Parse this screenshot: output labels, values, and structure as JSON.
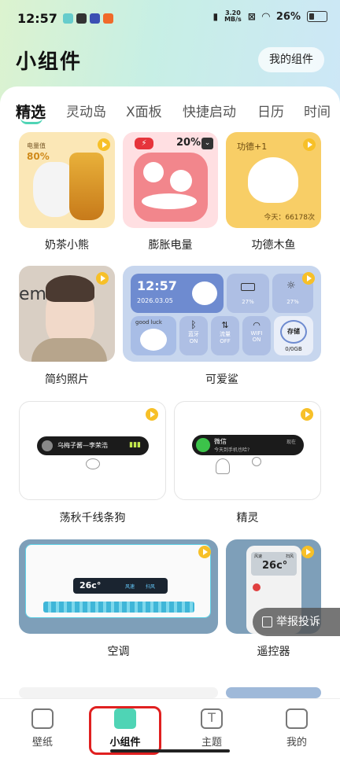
{
  "status_bar": {
    "time": "12:57",
    "speed_value": "3.20",
    "speed_unit": "MB/s",
    "battery": "26%"
  },
  "header": {
    "title": "小组件",
    "my_widgets_button": "我的组件"
  },
  "tabs": [
    "精选",
    "灵动岛",
    "X面板",
    "快捷启动",
    "日历",
    "时间"
  ],
  "widgets": {
    "milk_tea_bear": {
      "label": "奶茶小熊",
      "badge_title": "电量值",
      "badge_value": "80%"
    },
    "inflate_battery": {
      "label": "膨胀电量",
      "percent": "20%"
    },
    "merit_fish": {
      "label": "功德木鱼",
      "title": "功德+1",
      "today": "今天：66178次"
    },
    "simple_photo": {
      "label": "简约照片",
      "bg_text": "emb"
    },
    "cute_shark": {
      "label": "可爱鲨",
      "time": "12:57",
      "date": "2026.03.05",
      "tag": "good luck",
      "battery_a": "27%",
      "battery_b": "27%",
      "bluetooth": "蓝牙",
      "bluetooth_state": "ON",
      "data": "流量",
      "data_state": "OFF",
      "wifi": "WIFI",
      "wifi_state": "ON",
      "storage": "存储",
      "storage_value": "0/0GB"
    },
    "swing_dog": {
      "label": "荡秋千线条狗",
      "song": "乌梅子酱—李荣浩"
    },
    "spirit": {
      "label": "精灵",
      "title": "微信",
      "subtitle": "今天到手机也哈?",
      "time": "现在"
    },
    "air_conditioner": {
      "label": "空调",
      "temp": "26c°",
      "mode": "风速",
      "mode2": "扫风"
    },
    "remote": {
      "label": "遥控器",
      "temp": "26c°",
      "top_left": "风速",
      "top_right": "扫风"
    }
  },
  "report_button": "举报投诉",
  "bottom_nav": [
    {
      "label": "壁纸"
    },
    {
      "label": "小组件"
    },
    {
      "label": "主题"
    },
    {
      "label": "我的"
    }
  ],
  "colors": {
    "accent": "#4fd4b5",
    "play_badge": "#f7c028",
    "highlight": "#e02020"
  }
}
